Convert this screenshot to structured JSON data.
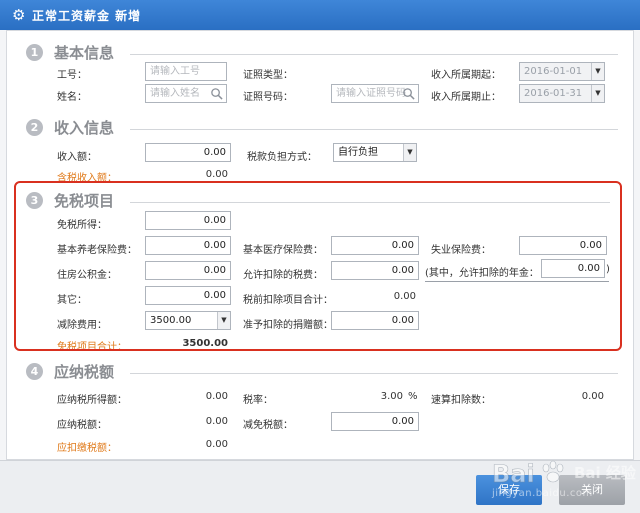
{
  "window": {
    "title": "正常工资薪金 新增"
  },
  "sections": {
    "basic": {
      "num": "1",
      "title": "基本信息"
    },
    "income": {
      "num": "2",
      "title": "收入信息"
    },
    "exempt": {
      "num": "3",
      "title": "免税项目"
    },
    "tax": {
      "num": "4",
      "title": "应纳税额"
    }
  },
  "basic": {
    "emp_id_label": "工号：",
    "emp_id_placeholder": "请输入工号",
    "name_label": "姓名：",
    "name_placeholder": "请输入姓名",
    "id_type_label": "证照类型：",
    "id_no_label": "证照号码：",
    "id_no_placeholder": "请输入证照号码",
    "period_start_label": "收入所属期起：",
    "period_start": "2016-01-01",
    "period_end_label": "收入所属期止：",
    "period_end": "2016-01-31"
  },
  "income": {
    "amount_label": "收入额：",
    "amount": "0.00",
    "tax_bearer_label": "税款负担方式：",
    "tax_bearer": "自行负担",
    "taxable_income_label": "含税收入额：",
    "taxable_income": "0.00"
  },
  "exempt": {
    "exempt_income_label": "免税所得：",
    "exempt_income": "0.00",
    "pension_label": "基本养老保险费：",
    "pension": "0.00",
    "medical_label": "基本医疗保险费：",
    "medical": "0.00",
    "unemployment_label": "失业保险费：",
    "unemployment": "0.00",
    "housing_label": "住房公积金：",
    "housing": "0.00",
    "allowed_tax_label": "允许扣除的税费：",
    "allowed_tax": "0.00",
    "annuity_label": "(其中，允许扣除的年金：",
    "annuity": "0.00",
    "annuity_close": ")",
    "other_label": "其它：",
    "other": "0.00",
    "pretax_total_label": "税前扣除项目合计：",
    "pretax_total": "0.00",
    "deduction_label": "减除费用：",
    "deduction": "3500.00",
    "donation_label": "准予扣除的捐赠额：",
    "donation": "0.00",
    "exempt_total_label": "免税项目合计：",
    "exempt_total": "3500.00"
  },
  "tax": {
    "taxable_amount_label": "应纳税所得额：",
    "taxable_amount": "0.00",
    "rate_label": "税率：",
    "rate": "3.00",
    "rate_unit": "%",
    "quick_deduction_label": "速算扣除数：",
    "quick_deduction": "0.00",
    "tax_payable_label": "应纳税额：",
    "tax_payable": "0.00",
    "tax_relief_label": "减免税额：",
    "tax_relief": "0.00",
    "withholding_label": "应扣缴税额：",
    "withholding": "0.00"
  },
  "buttons": {
    "save": "保存",
    "close": "关闭"
  },
  "watermark": {
    "text": "Bai 经验",
    "url": "jingyan.baidu.com"
  }
}
